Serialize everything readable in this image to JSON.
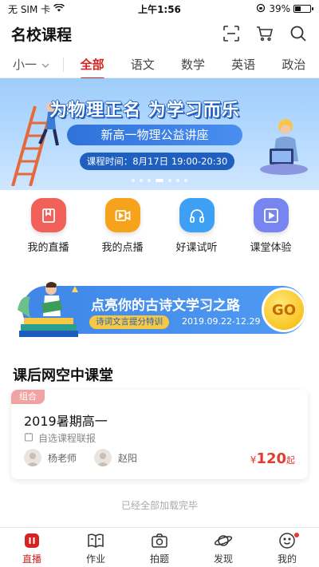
{
  "status_bar": {
    "carrier": "无 SIM 卡",
    "time": "上午1:56",
    "battery_percent": "39%",
    "battery_level": 0.39
  },
  "header": {
    "title": "名校课程"
  },
  "tabs": {
    "grade": "小一",
    "items": [
      "全部",
      "语文",
      "数学",
      "英语",
      "政治"
    ],
    "active_index": 0
  },
  "banner": {
    "headline": "为物理正名 为学习而乐",
    "subtitle": "新高一物理公益讲座",
    "time_text": "课程时间：8月17日 19:00-20:30",
    "dot_count": 7,
    "active_dot": 3
  },
  "quick_actions": [
    {
      "label": "我的直播",
      "icon": "bookmark-icon",
      "color": "#f2605a"
    },
    {
      "label": "我的点播",
      "icon": "video-icon",
      "color": "#f7a21b"
    },
    {
      "label": "好课试听",
      "icon": "headphones-icon",
      "color": "#3ea0f4"
    },
    {
      "label": "课堂体验",
      "icon": "play-screen-icon",
      "color": "#7785f0"
    }
  ],
  "promo": {
    "title": "点亮你的古诗文学习之路",
    "tag": "诗词文言提分特训",
    "dates": "2019.09.22-12.29",
    "go_label": "GO"
  },
  "section": {
    "title": "课后网空中课堂"
  },
  "course_card": {
    "badge": "组合",
    "title": "2019暑期高一",
    "meta": "自选课程联报",
    "teachers": [
      "杨老师",
      "赵阳"
    ],
    "price_currency": "¥",
    "price_value": "120",
    "price_suffix": "起"
  },
  "end_note": "已经全部加载完毕",
  "bottom_nav": [
    {
      "label": "直播",
      "icon": "live-icon",
      "active": true
    },
    {
      "label": "作业",
      "icon": "book-icon",
      "active": false
    },
    {
      "label": "拍题",
      "icon": "camera-icon",
      "active": false
    },
    {
      "label": "发现",
      "icon": "planet-icon",
      "active": false
    },
    {
      "label": "我的",
      "icon": "smile-icon",
      "active": false,
      "has_dot": true
    }
  ],
  "colors": {
    "accent": "#d72222",
    "price": "#e03c2f"
  }
}
